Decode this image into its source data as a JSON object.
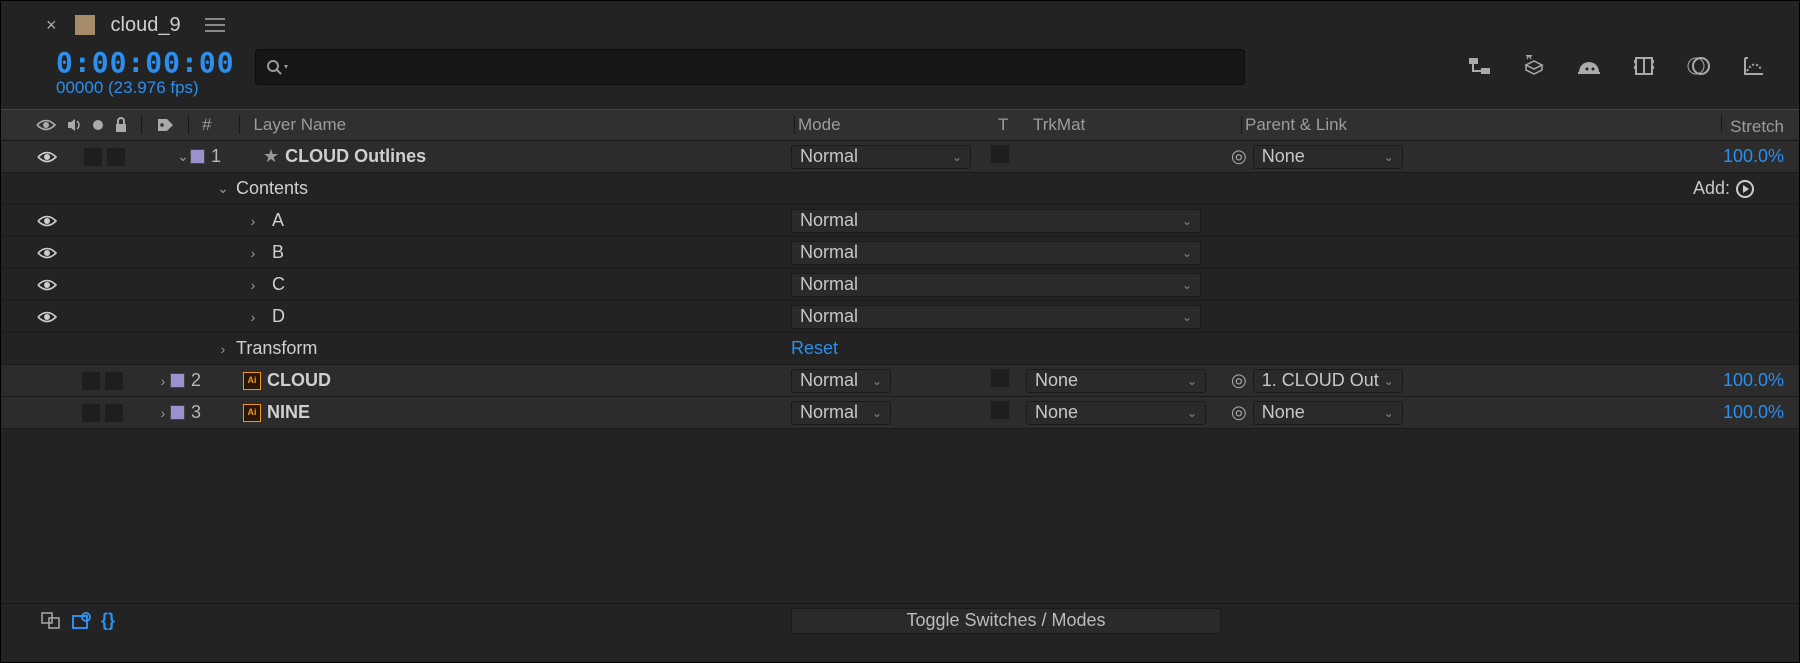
{
  "tab": {
    "name": "cloud_9"
  },
  "timecode": {
    "main": "0:00:00:00",
    "sub": "00000 (23.976 fps)"
  },
  "search": {
    "placeholder": ""
  },
  "columns": {
    "hash": "#",
    "layerName": "Layer Name",
    "mode": "Mode",
    "t": "T",
    "trkmat": "TrkMat",
    "parent": "Parent & Link",
    "stretch": "Stretch"
  },
  "contentsLabel": "Contents",
  "addLabel": "Add:",
  "transformLabel": "Transform",
  "resetLabel": "Reset",
  "layers": [
    {
      "index": "1",
      "name": "CLOUD Outlines",
      "mode": "Normal",
      "trk": "",
      "parent": "None",
      "stretch": "100.0%",
      "type": "shape",
      "contents": [
        {
          "name": "A",
          "mode": "Normal"
        },
        {
          "name": "B",
          "mode": "Normal"
        },
        {
          "name": "C",
          "mode": "Normal"
        },
        {
          "name": "D",
          "mode": "Normal"
        }
      ]
    },
    {
      "index": "2",
      "name": "CLOUD",
      "mode": "Normal",
      "trk": "None",
      "parent": "1. CLOUD Out",
      "stretch": "100.0%",
      "type": "ai"
    },
    {
      "index": "3",
      "name": "NINE",
      "mode": "Normal",
      "trk": "None",
      "parent": "None",
      "stretch": "100.0%",
      "type": "ai"
    }
  ],
  "footer": {
    "toggle": "Toggle Switches / Modes"
  }
}
